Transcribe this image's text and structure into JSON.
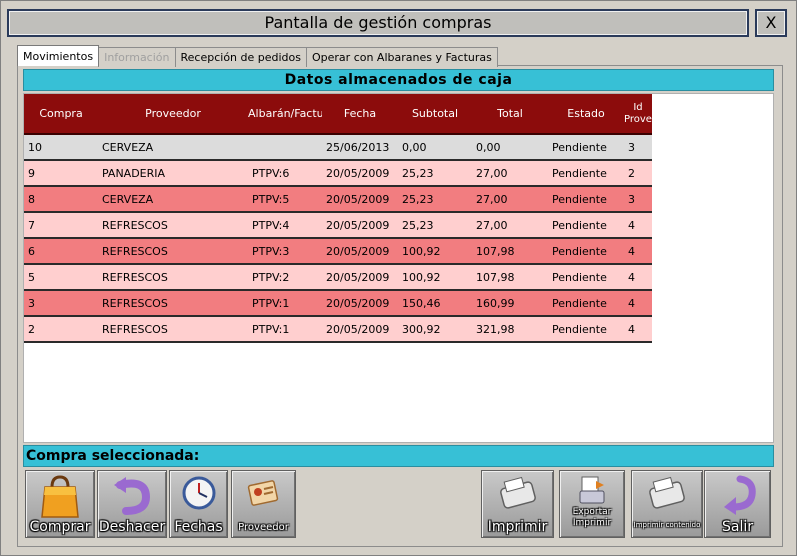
{
  "window": {
    "title": "Pantalla de gestión compras",
    "close_label": "X"
  },
  "tabs": [
    {
      "label": "Movimientos",
      "state": "active"
    },
    {
      "label": "Información",
      "state": "disabled"
    },
    {
      "label": "Recepción de pedidos",
      "state": "normal"
    },
    {
      "label": "Operar con Albaranes y Facturas",
      "state": "normal"
    }
  ],
  "table_section": {
    "title": "Datos almacenados de caja",
    "columns": [
      "Compra",
      "Proveedor",
      "Albarán/Factura",
      "Fecha",
      "Subtotal",
      "Total",
      "Estado",
      "Id Proveedor"
    ],
    "rows": [
      {
        "compra": "10",
        "proveedor": "CERVEZA",
        "albaran": "",
        "fecha": "25/06/2013",
        "subtotal": "0,00",
        "total": "0,00",
        "estado": "Pendiente",
        "id": "3",
        "style": "r0"
      },
      {
        "compra": "9",
        "proveedor": "PANADERIA",
        "albaran": "PTPV:6",
        "fecha": "20/05/2009",
        "subtotal": "25,23",
        "total": "27,00",
        "estado": "Pendiente",
        "id": "2",
        "style": "r1"
      },
      {
        "compra": "8",
        "proveedor": "CERVEZA",
        "albaran": "PTPV:5",
        "fecha": "20/05/2009",
        "subtotal": "25,23",
        "total": "27,00",
        "estado": "Pendiente",
        "id": "3",
        "style": "r2"
      },
      {
        "compra": "7",
        "proveedor": "REFRESCOS",
        "albaran": "PTPV:4",
        "fecha": "20/05/2009",
        "subtotal": "25,23",
        "total": "27,00",
        "estado": "Pendiente",
        "id": "4",
        "style": "r1"
      },
      {
        "compra": "6",
        "proveedor": "REFRESCOS",
        "albaran": "PTPV:3",
        "fecha": "20/05/2009",
        "subtotal": "100,92",
        "total": "107,98",
        "estado": "Pendiente",
        "id": "4",
        "style": "r2"
      },
      {
        "compra": "5",
        "proveedor": "REFRESCOS",
        "albaran": "PTPV:2",
        "fecha": "20/05/2009",
        "subtotal": "100,92",
        "total": "107,98",
        "estado": "Pendiente",
        "id": "4",
        "style": "r1"
      },
      {
        "compra": "3",
        "proveedor": "REFRESCOS",
        "albaran": "PTPV:1",
        "fecha": "20/05/2009",
        "subtotal": "150,46",
        "total": "160,99",
        "estado": "Pendiente",
        "id": "4",
        "style": "r2"
      },
      {
        "compra": "2",
        "proveedor": "REFRESCOS",
        "albaran": "PTPV:1",
        "fecha": "20/05/2009",
        "subtotal": "300,92",
        "total": "321,98",
        "estado": "Pendiente",
        "id": "4",
        "style": "r1"
      }
    ]
  },
  "selection_section": {
    "title": "Compra seleccionada:"
  },
  "toolbar": {
    "comprar": {
      "label": "Comprar",
      "icon": "shopping-bag-icon"
    },
    "deshacer": {
      "label": "Deshacer",
      "icon": "undo-arrow-icon"
    },
    "fechas": {
      "label": "Fechas",
      "icon": "clock-icon"
    },
    "proveedor": {
      "label": "Proveedor",
      "icon": "supplier-card-icon"
    },
    "imprimir": {
      "label": "Imprimir",
      "icon": "printer-icon"
    },
    "exportar": {
      "label": "Exportar Imprimir",
      "icon": "export-print-icon"
    },
    "imprimir_contenido": {
      "label": "Imprimir contenido",
      "icon": "printer-icon"
    },
    "salir": {
      "label": "Salir",
      "icon": "exit-arrow-icon"
    }
  },
  "colors": {
    "header_bg": "#8c0c0c",
    "section_bar": "#37c0d6",
    "row_gray": "#dcdcdc",
    "row_light_pink": "#ffcfcf",
    "row_salmon": "#f27d80"
  }
}
